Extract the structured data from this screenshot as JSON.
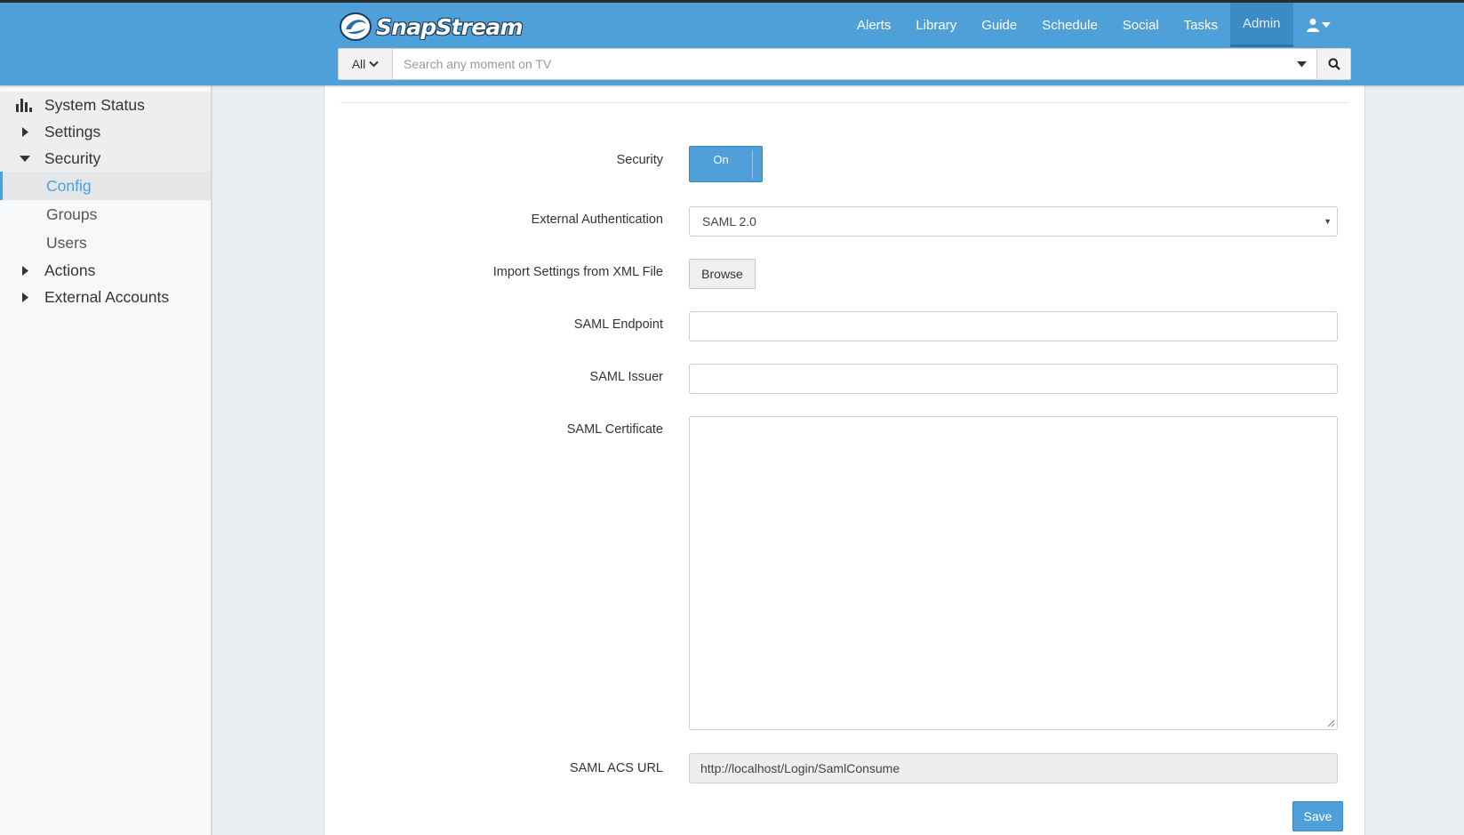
{
  "app": {
    "logo_text": "SnapStream"
  },
  "nav": {
    "items": [
      {
        "label": "Alerts"
      },
      {
        "label": "Library"
      },
      {
        "label": "Guide"
      },
      {
        "label": "Schedule"
      },
      {
        "label": "Social"
      },
      {
        "label": "Tasks"
      },
      {
        "label": "Admin",
        "active": true
      }
    ],
    "user_icon": "user-icon"
  },
  "search": {
    "scope": "All",
    "placeholder": "Search any moment on TV",
    "value": ""
  },
  "sidebar": {
    "items": [
      {
        "label": "System Status",
        "icon": "bar-chart-icon"
      },
      {
        "label": "Settings",
        "icon": "caret-right-icon"
      },
      {
        "label": "Security",
        "icon": "caret-down-icon",
        "expanded": true
      },
      {
        "label": "Config",
        "active": true
      },
      {
        "label": "Groups"
      },
      {
        "label": "Users"
      },
      {
        "label": "Actions",
        "icon": "caret-right-icon"
      },
      {
        "label": "External Accounts",
        "icon": "caret-right-icon"
      }
    ]
  },
  "form": {
    "security": {
      "label": "Security",
      "toggle": "On"
    },
    "external_auth": {
      "label": "External Authentication",
      "value": "SAML 2.0"
    },
    "import": {
      "label": "Import Settings from XML File",
      "button": "Browse"
    },
    "saml_endpoint": {
      "label": "SAML Endpoint",
      "value": ""
    },
    "saml_issuer": {
      "label": "SAML Issuer",
      "value": ""
    },
    "saml_certificate": {
      "label": "SAML Certificate",
      "value": ""
    },
    "saml_acs_url": {
      "label": "SAML ACS URL",
      "value": "http://localhost/Login/SamlConsume"
    },
    "save": "Save"
  },
  "colors": {
    "header": "#4f9fd8",
    "accent": "#4f9fd8"
  }
}
